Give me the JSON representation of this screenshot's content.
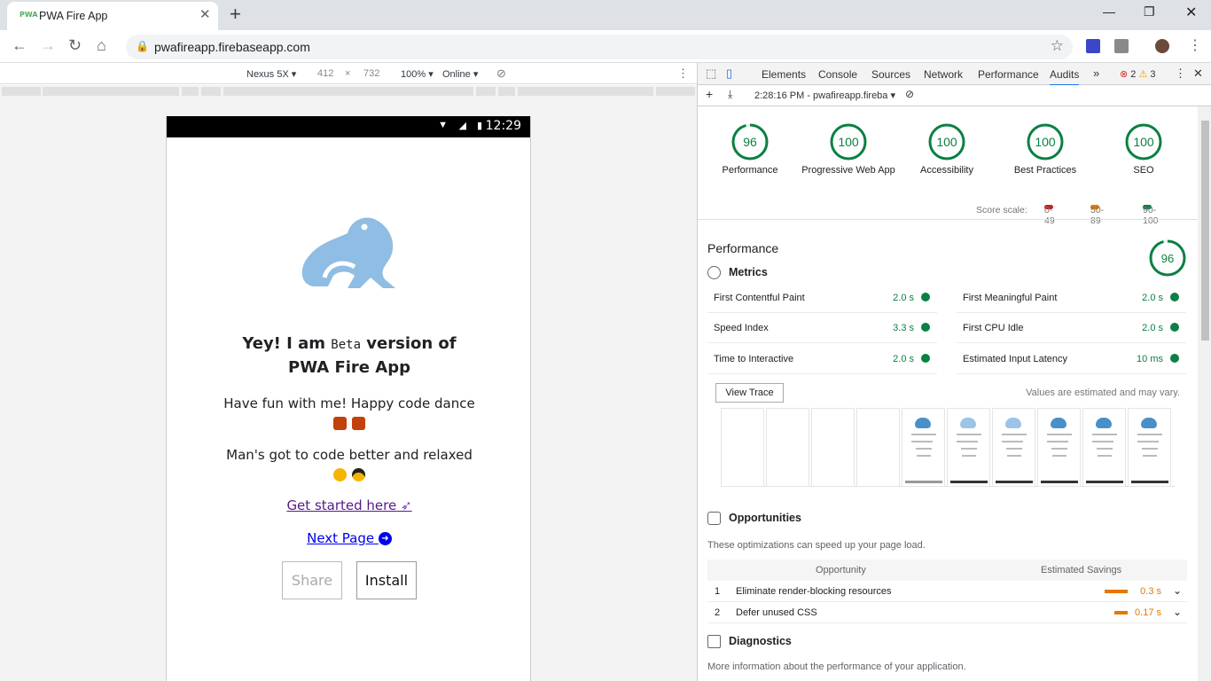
{
  "browser": {
    "tab_title": "PWA Fire App",
    "tab_favicon": "PWA",
    "url": "pwafireapp.firebaseapp.com"
  },
  "device_toolbar": {
    "device": "Nexus 5X",
    "width": "412",
    "times": "×",
    "height": "732",
    "zoom": "100%",
    "network": "Online"
  },
  "phone": {
    "time": "12:29",
    "heading_prefix": "Yey! I am ",
    "heading_code": "Beta",
    "heading_suffix": " version of PWA Fire App",
    "fun_text": "Have fun with me! Happy code dance",
    "man_text": "Man's got to code better and relaxed",
    "get_started": "Get started here",
    "next_page": "Next Page",
    "share_button": "Share",
    "install_button": "Install"
  },
  "devtools": {
    "tabs": [
      "Elements",
      "Console",
      "Sources",
      "Network",
      "Performance",
      "Audits"
    ],
    "more": "»",
    "errors": "2",
    "warnings": "3",
    "audit_run": "2:28:16 PM - pwafireapp.fireba"
  },
  "audit": {
    "gauges": [
      {
        "score": "96",
        "label": "Performance"
      },
      {
        "score": "100",
        "label": "Progressive Web App"
      },
      {
        "score": "100",
        "label": "Accessibility"
      },
      {
        "score": "100",
        "label": "Best Practices"
      },
      {
        "score": "100",
        "label": "SEO"
      }
    ],
    "score_scale_label": "Score scale:",
    "scale": [
      "0-49",
      "50-89",
      "90-100"
    ],
    "scale_colors": [
      "#c5221f",
      "#e67700",
      "#0b8043"
    ],
    "performance_title": "Performance",
    "performance_score": "96",
    "metrics_title": "Metrics",
    "metrics": [
      {
        "name": "First Contentful Paint",
        "value": "2.0 s"
      },
      {
        "name": "First Meaningful Paint",
        "value": "2.0 s"
      },
      {
        "name": "Speed Index",
        "value": "3.3 s"
      },
      {
        "name": "First CPU Idle",
        "value": "2.0 s"
      },
      {
        "name": "Time to Interactive",
        "value": "2.0 s"
      },
      {
        "name": "Estimated Input Latency",
        "value": "10 ms"
      }
    ],
    "view_trace": "View Trace",
    "estimated_note": "Values are estimated and may vary.",
    "opportunities_title": "Opportunities",
    "opportunities_desc": "These optimizations can speed up your page load.",
    "opp_col1": "Opportunity",
    "opp_col2": "Estimated Savings",
    "opportunities": [
      {
        "num": "1",
        "name": "Eliminate render-blocking resources",
        "savings": "0.3 s",
        "fraction": 0.6
      },
      {
        "num": "2",
        "name": "Defer unused CSS",
        "savings": "0.17 s",
        "fraction": 0.34
      }
    ],
    "diagnostics_title": "Diagnostics",
    "diagnostics_desc": "More information about the performance of your application."
  }
}
